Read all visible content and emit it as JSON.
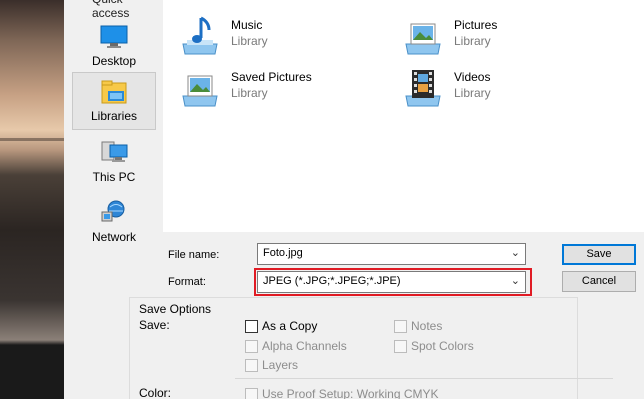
{
  "nav": {
    "heading": "Quick access",
    "items": [
      {
        "label": "Desktop",
        "icon": "desktop-icon"
      },
      {
        "label": "Libraries",
        "icon": "libraries-icon",
        "selected": true
      },
      {
        "label": "This PC",
        "icon": "computer-icon"
      },
      {
        "label": "Network",
        "icon": "network-icon"
      }
    ]
  },
  "libraries": [
    {
      "name": "Music",
      "type": "Library",
      "icon": "music-library-icon"
    },
    {
      "name": "Pictures",
      "type": "Library",
      "icon": "pictures-library-icon"
    },
    {
      "name": "Saved Pictures",
      "type": "Library",
      "icon": "saved-pictures-library-icon"
    },
    {
      "name": "Videos",
      "type": "Library",
      "icon": "videos-library-icon"
    }
  ],
  "form": {
    "filename_label": "File name:",
    "filename_value": "Foto.jpg",
    "format_label": "Format:",
    "format_value": "JPEG (*.JPG;*.JPEG;*.JPE)",
    "save_label": "Save",
    "cancel_label": "Cancel"
  },
  "save_options": {
    "title": "Save Options",
    "save_label": "Save:",
    "color_label": "Color:",
    "checkboxes": {
      "as_a_copy": "As a Copy",
      "notes": "Notes",
      "alpha_channels": "Alpha Channels",
      "spot_colors": "Spot Colors",
      "layers": "Layers",
      "use_proof_setup": "Use Proof Setup:  Working CMYK"
    }
  },
  "colors": {
    "accent": "#0078d7",
    "highlight": "#e01b24"
  }
}
